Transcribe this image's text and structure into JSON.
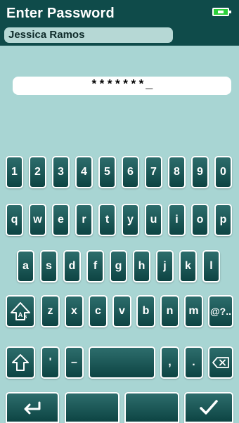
{
  "header": {
    "title": "Enter Password",
    "user_name": "Jessica Ramos"
  },
  "battery": {
    "color": "#2bcf3a",
    "icon": "battery-charging-icon"
  },
  "password": {
    "masked_value": "*******_"
  },
  "keyboard": {
    "row1": [
      "1",
      "2",
      "3",
      "4",
      "5",
      "6",
      "7",
      "8",
      "9",
      "0"
    ],
    "row2": [
      "q",
      "w",
      "e",
      "r",
      "t",
      "y",
      "u",
      "i",
      "o",
      "p"
    ],
    "row3": [
      "a",
      "s",
      "d",
      "f",
      "g",
      "h",
      "j",
      "k",
      "l"
    ],
    "row4": [
      "z",
      "x",
      "c",
      "v",
      "b",
      "n",
      "m"
    ],
    "symbols_label": "@?..",
    "apostrophe": "'",
    "dash": "–",
    "comma": ",",
    "period": "."
  },
  "colors": {
    "background": "#a8d5d3",
    "header": "#0f4b4a",
    "key_top": "#2d6d6c",
    "key_bottom": "#0d4443"
  }
}
